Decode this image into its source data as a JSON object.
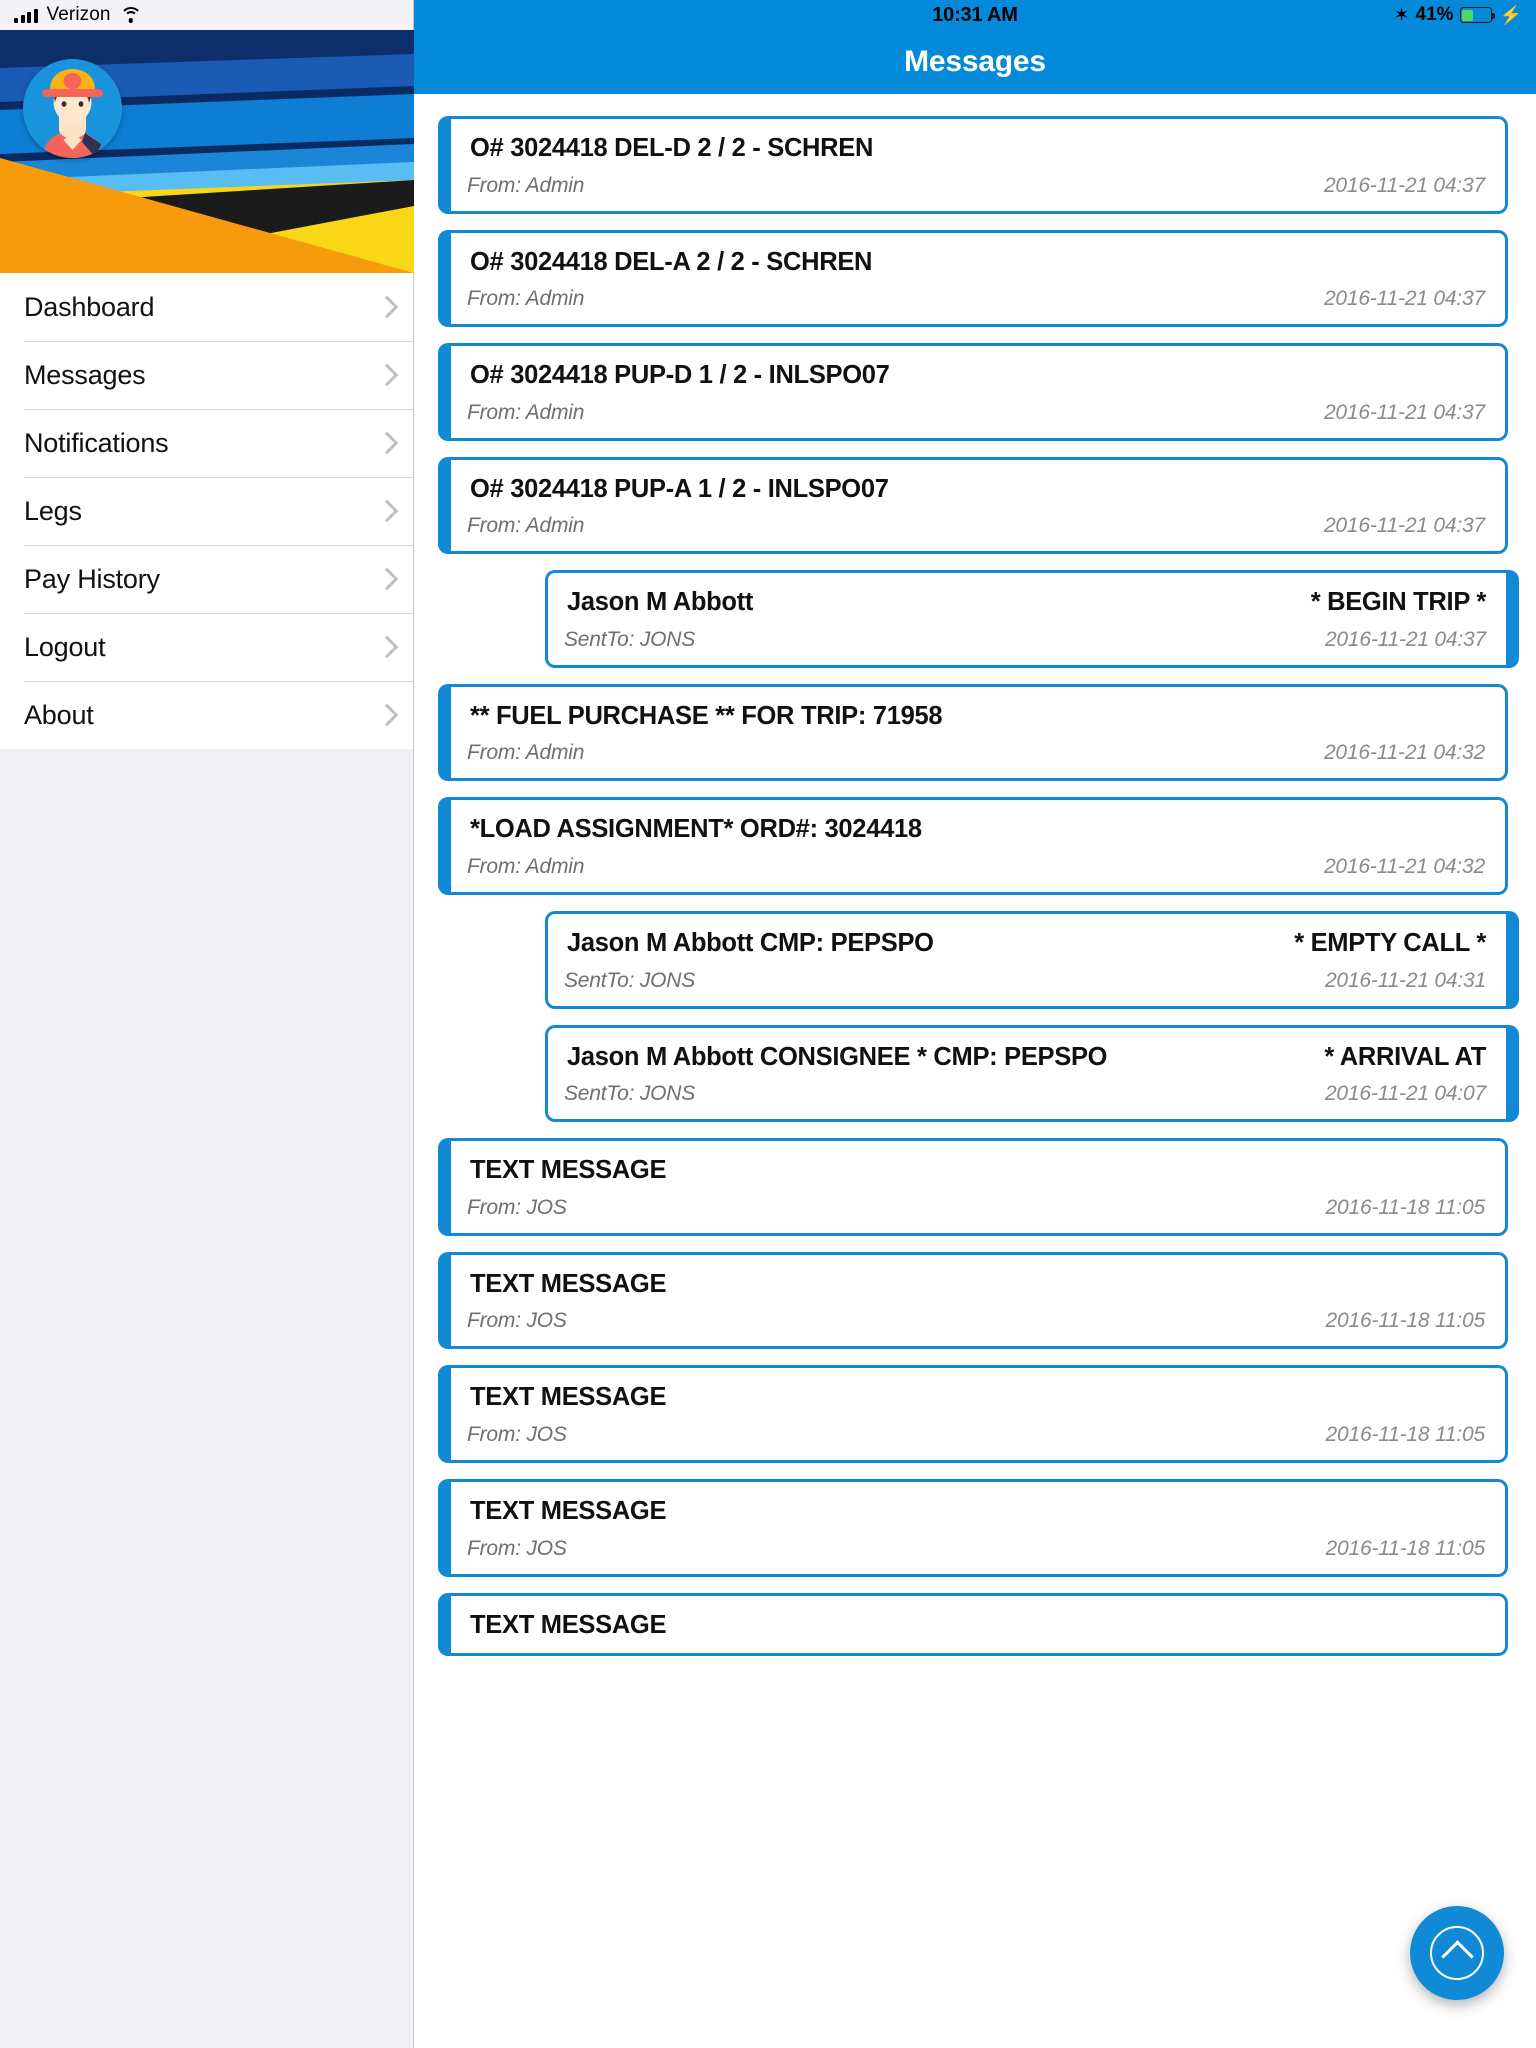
{
  "sidebar": {
    "status": {
      "carrier": "Verizon",
      "signal_icon": "signal-bars-icon",
      "wifi_icon": "wifi-icon"
    },
    "avatar_icon": "driver-avatar",
    "menu": [
      {
        "label": "Dashboard"
      },
      {
        "label": "Messages"
      },
      {
        "label": "Notifications"
      },
      {
        "label": "Legs"
      },
      {
        "label": "Pay History"
      },
      {
        "label": "Logout"
      },
      {
        "label": "About"
      }
    ]
  },
  "main": {
    "status": {
      "time": "10:31 AM",
      "bluetooth_icon": "bluetooth-icon",
      "battery_percent": "41%",
      "battery_icon": "battery-icon",
      "charging_icon": "lightning-bolt-icon"
    },
    "nav_title": "Messages",
    "fab_icon": "scroll-to-top-icon",
    "messages": [
      {
        "dir": "in",
        "title": "O# 3024418  DEL-D 2  / 2  - SCHREN",
        "right": "",
        "from": "From: Admin",
        "time": "2016-11-21 04:37"
      },
      {
        "dir": "in",
        "title": "O# 3024418  DEL-A 2  / 2  - SCHREN",
        "right": "",
        "from": "From: Admin",
        "time": "2016-11-21 04:37"
      },
      {
        "dir": "in",
        "title": "O# 3024418  PUP-D 1  / 2  - INLSPO07",
        "right": "",
        "from": "From: Admin",
        "time": "2016-11-21 04:37"
      },
      {
        "dir": "in",
        "title": "O# 3024418  PUP-A 1  / 2  - INLSPO07",
        "right": "",
        "from": "From: Admin",
        "time": "2016-11-21 04:37"
      },
      {
        "dir": "out",
        "title": "Jason M Abbott",
        "right": "* BEGIN TRIP *",
        "from": "SentTo: JONS",
        "time": "2016-11-21 04:37"
      },
      {
        "dir": "in",
        "title": "** FUEL PURCHASE ** FOR TRIP: 71958",
        "right": "",
        "from": "From: Admin",
        "time": "2016-11-21 04:32"
      },
      {
        "dir": "in",
        "title": "*LOAD ASSIGNMENT* ORD#: 3024418",
        "right": "",
        "from": "From: Admin",
        "time": "2016-11-21 04:32"
      },
      {
        "dir": "out",
        "title": "Jason M Abbott CMP: PEPSPO",
        "right": "* EMPTY CALL *",
        "from": "SentTo: JONS",
        "time": "2016-11-21 04:31"
      },
      {
        "dir": "out",
        "title": "Jason M Abbott CONSIGNEE * CMP: PEPSPO",
        "right": "* ARRIVAL AT",
        "from": "SentTo: JONS",
        "time": "2016-11-21 04:07"
      },
      {
        "dir": "in",
        "title": "TEXT MESSAGE",
        "right": "",
        "from": "From: JOS",
        "time": "2016-11-18 11:05"
      },
      {
        "dir": "in",
        "title": "TEXT MESSAGE",
        "right": "",
        "from": "From: JOS",
        "time": "2016-11-18 11:05"
      },
      {
        "dir": "in",
        "title": "TEXT MESSAGE",
        "right": "",
        "from": "From: JOS",
        "time": "2016-11-18 11:05"
      },
      {
        "dir": "in",
        "title": "TEXT MESSAGE",
        "right": "",
        "from": "From: JOS",
        "time": "2016-11-18 11:05"
      },
      {
        "dir": "in",
        "title": "TEXT MESSAGE",
        "right": "",
        "from": "",
        "time": ""
      }
    ]
  },
  "colors": {
    "accent": "#048ad8",
    "card_border": "#1189d4",
    "sidebar_bg": "#efeff4"
  }
}
